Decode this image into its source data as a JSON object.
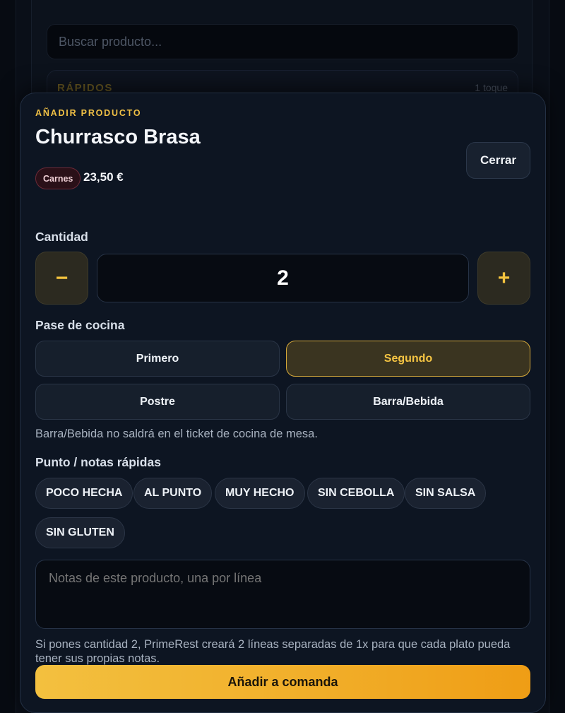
{
  "background": {
    "search_placeholder": "Buscar producto...",
    "quick_title": "RÁPIDOS",
    "quick_hint": "1 toque"
  },
  "modal": {
    "eyebrow": "AÑADIR PRODUCTO",
    "title": "Churrasco Brasa",
    "close_label": "Cerrar",
    "category": "Carnes",
    "price": "23,50 €",
    "quantity": {
      "label": "Cantidad",
      "minus": "−",
      "plus": "+",
      "value": "2"
    },
    "course": {
      "label": "Pase de cocina",
      "options": [
        "Primero",
        "Segundo",
        "Postre",
        "Barra/Bebida"
      ],
      "selected": "Segundo",
      "help": "Barra/Bebida no saldrá en el ticket de cocina de mesa."
    },
    "notes": {
      "label": "Punto / notas rápidas",
      "chips": [
        "POCO HECHA",
        "AL PUNTO",
        "MUY HECHO",
        "SIN CEBOLLA",
        "SIN SALSA",
        "SIN GLUTEN"
      ],
      "placeholder": "Notas de este producto, una por línea",
      "info": "Si pones cantidad 2, PrimeRest creará 2 líneas separadas de 1x para que cada plato pueda tener sus propias notas."
    },
    "submit_label": "Añadir a comanda"
  },
  "colors": {
    "accent": "#f3c03f",
    "background": "#0d1522",
    "category_badge": "#2a1018"
  }
}
